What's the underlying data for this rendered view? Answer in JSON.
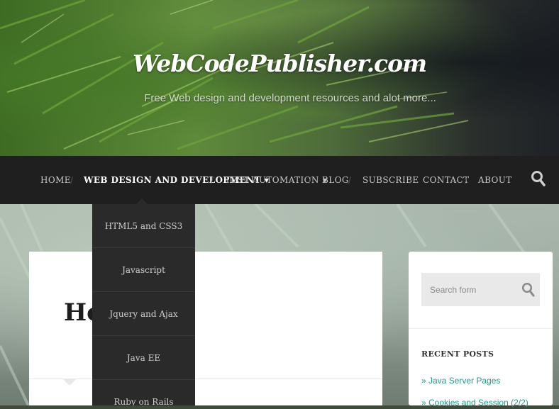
{
  "header": {
    "site_title": "WebCodePublisher.com",
    "tagline": "Free Web design and development resources and alot more..."
  },
  "nav": {
    "items": [
      {
        "label": "Home",
        "active": false,
        "has_submenu": false
      },
      {
        "label": "Web Design and Development",
        "active": true,
        "has_submenu": true
      },
      {
        "label": "Test Automation",
        "active": false,
        "has_submenu": true
      },
      {
        "label": "Blog",
        "active": false,
        "has_submenu": false
      },
      {
        "label": "Subscribe",
        "active": false,
        "has_submenu": false
      },
      {
        "label": "Contact",
        "active": false,
        "has_submenu": false
      },
      {
        "label": "About",
        "active": false,
        "has_submenu": false
      }
    ],
    "search_icon": "search-icon"
  },
  "dropdown": {
    "items": [
      {
        "label": "HTML5 and CSS3"
      },
      {
        "label": "Javascript"
      },
      {
        "label": "Jquery and Ajax"
      },
      {
        "label": "Java EE"
      },
      {
        "label": "Ruby on Rails"
      }
    ]
  },
  "main": {
    "page_title": "Home"
  },
  "sidebar": {
    "search": {
      "placeholder": "Search form",
      "value": ""
    },
    "recent_posts": {
      "title": "Recent Posts",
      "items": [
        {
          "label": "» Java Server Pages"
        },
        {
          "label": "» Cookies and Session (2/2)"
        }
      ]
    }
  },
  "colors": {
    "nav_bg": "#1f1f1f",
    "dropdown_bg": "#2a2a2a",
    "link": "#1e9b8a"
  }
}
